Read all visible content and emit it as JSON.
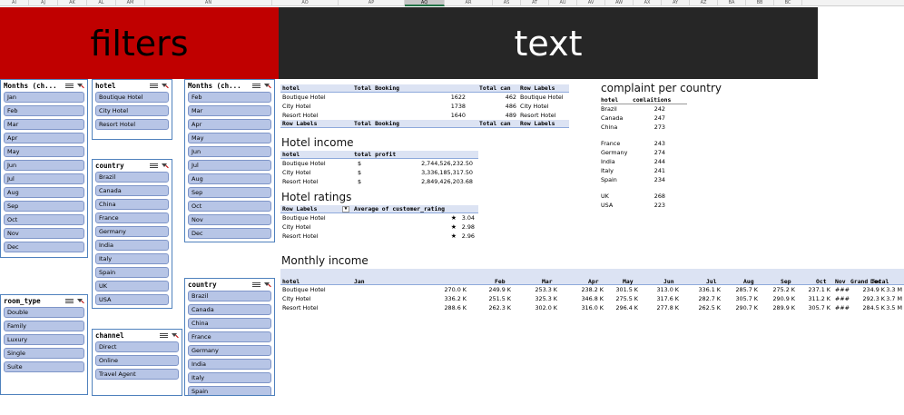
{
  "column_headers": [
    "AI",
    "AJ",
    "AK",
    "AL",
    "AM",
    "AN",
    "AO",
    "AP",
    "AQ",
    "AR",
    "AS",
    "AT",
    "AU",
    "AV",
    "AW",
    "AX",
    "AY",
    "AZ",
    "BA",
    "BB",
    "BC"
  ],
  "selected_column": "AQ",
  "banners": {
    "filters": "filters",
    "text": "text"
  },
  "slicers": {
    "months1": {
      "title": "Months (ch...",
      "items": [
        "Jan",
        "Feb",
        "Mar",
        "Apr",
        "May",
        "Jun",
        "Jul",
        "Aug",
        "Sep",
        "Oct",
        "Nov",
        "Dec"
      ]
    },
    "hotel": {
      "title": "hotel",
      "items": [
        "Boutique Hotel",
        "City Hotel",
        "Resort Hotel"
      ]
    },
    "months2": {
      "title": "Months (ch...",
      "items": [
        "Feb",
        "Mar",
        "Apr",
        "May",
        "Jun",
        "Jul",
        "Aug",
        "Sep",
        "Oct",
        "Nov",
        "Dec"
      ]
    },
    "country1": {
      "title": "country",
      "items": [
        "Brazil",
        "Canada",
        "China",
        "France",
        "Germany",
        "India",
        "Italy",
        "Spain",
        "UK",
        "USA"
      ]
    },
    "room_type": {
      "title": "room_type",
      "items": [
        "Double",
        "Family",
        "Luxury",
        "Single",
        "Suite"
      ]
    },
    "channel": {
      "title": "channel",
      "items": [
        "Direct",
        "Online",
        "Travel Agent"
      ]
    },
    "country2": {
      "title": "country",
      "items": [
        "Brazil",
        "Canada",
        "China",
        "France",
        "Germany",
        "India",
        "Italy",
        "Spain"
      ]
    }
  },
  "booking": {
    "headers": [
      "hotel",
      "Total Booking",
      "Total can",
      "Row Labels"
    ],
    "rows": [
      {
        "hotel": "Boutique Hotel",
        "total": "1622",
        "cancel": "462",
        "label": "Boutique Hotel"
      },
      {
        "hotel": "City Hotel",
        "total": "1738",
        "cancel": "486",
        "label": "City Hotel"
      },
      {
        "hotel": "Resort Hotel",
        "total": "1640",
        "cancel": "489",
        "label": "Resort Hotel"
      }
    ],
    "footer": [
      "Row Labels",
      "Total Booking",
      "Total can",
      "Row Labels"
    ]
  },
  "income": {
    "title": "Hotel income",
    "headers": [
      "hotel",
      "total profit"
    ],
    "rows": [
      {
        "hotel": "Boutique Hotel",
        "cur": "$",
        "value": "2,744,526,232.50"
      },
      {
        "hotel": "City Hotel",
        "cur": "$",
        "value": "3,336,185,317.50"
      },
      {
        "hotel": "Resort Hotel",
        "cur": "$",
        "value": "2,849,426,203.68"
      }
    ]
  },
  "ratings": {
    "title": "Hotel ratings",
    "headers": [
      "Row Labels",
      "Average of customer_rating"
    ],
    "rows": [
      {
        "hotel": "Boutique Hotel",
        "value": "3.04"
      },
      {
        "hotel": "City Hotel",
        "value": "2.98"
      },
      {
        "hotel": "Resort Hotel",
        "value": "2.96"
      }
    ]
  },
  "complaints": {
    "title": "complaint per country",
    "headers": [
      "hotel",
      "comlaitions"
    ],
    "rows": [
      {
        "country": "Brazil",
        "value": "242"
      },
      {
        "country": "Canada",
        "value": "247"
      },
      {
        "country": "China",
        "value": "273"
      },
      {
        "country": "France",
        "value": "243"
      },
      {
        "country": "Germany",
        "value": "274"
      },
      {
        "country": "India",
        "value": "244"
      },
      {
        "country": "Italy",
        "value": "241"
      },
      {
        "country": "Spain",
        "value": "234"
      },
      {
        "country": "UK",
        "value": "268"
      },
      {
        "country": "USA",
        "value": "223"
      }
    ]
  },
  "monthly": {
    "title": "Monthly income",
    "headers": [
      "hotel",
      "Jan",
      "Feb",
      "Mar",
      "Apr",
      "May",
      "Jun",
      "Jul",
      "Aug",
      "Sep",
      "Oct",
      "Nov",
      "Dec",
      "Grand Total"
    ],
    "rows": [
      {
        "hotel": "Boutique Hotel",
        "values": [
          "270.0 K",
          "249.9 K",
          "253.3 K",
          "238.2 K",
          "301.5 K",
          "313.0 K",
          "336.1 K",
          "285.7 K",
          "275.2 K",
          "237.1 K",
          "###",
          "234.9 K",
          "3.3 M"
        ]
      },
      {
        "hotel": "City Hotel",
        "values": [
          "336.2 K",
          "251.5 K",
          "325.3 K",
          "346.8 K",
          "275.5 K",
          "317.6 K",
          "282.7 K",
          "305.7 K",
          "290.9 K",
          "311.2 K",
          "###",
          "292.3 K",
          "3.7 M"
        ]
      },
      {
        "hotel": "Resort Hotel",
        "values": [
          "288.6 K",
          "262.3 K",
          "302.0 K",
          "316.0 K",
          "296.4 K",
          "277.8 K",
          "262.5 K",
          "290.7 K",
          "289.9 K",
          "305.7 K",
          "###",
          "284.5 K",
          "3.5 M"
        ]
      }
    ]
  }
}
